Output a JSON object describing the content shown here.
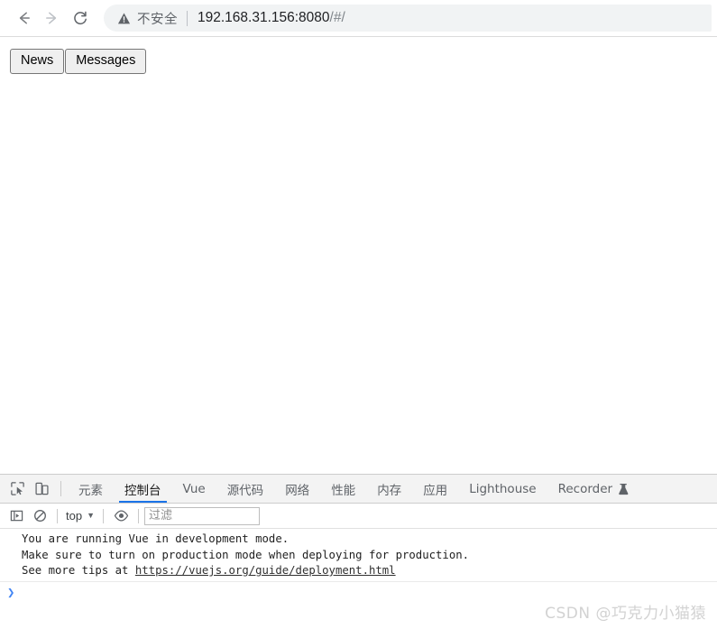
{
  "browser": {
    "nav": {
      "back_label": "Back",
      "forward_label": "Forward",
      "reload_label": "Reload"
    },
    "omnibox": {
      "security_icon": "warning-triangle-icon",
      "security_text": "不安全",
      "url_host": "192.168.31.156:8080",
      "url_path": "/#/"
    }
  },
  "page": {
    "buttons": [
      {
        "label": "News"
      },
      {
        "label": "Messages"
      }
    ]
  },
  "devtools": {
    "toolbar_icons": [
      {
        "name": "inspect-element-icon"
      },
      {
        "name": "device-toolbar-icon"
      }
    ],
    "tabs": [
      {
        "label": "元素",
        "active": false
      },
      {
        "label": "控制台",
        "active": true
      },
      {
        "label": "Vue",
        "active": false
      },
      {
        "label": "源代码",
        "active": false
      },
      {
        "label": "网络",
        "active": false
      },
      {
        "label": "性能",
        "active": false
      },
      {
        "label": "内存",
        "active": false
      },
      {
        "label": "应用",
        "active": false
      },
      {
        "label": "Lighthouse",
        "active": false
      },
      {
        "label": "Recorder",
        "active": false,
        "icon": "flask-icon"
      }
    ],
    "console_toolbar": {
      "sidebar_toggle_icon": "console-sidebar-icon",
      "clear_icon": "clear-console-icon",
      "context_value": "top",
      "context_caret": "▼",
      "eye_icon": "live-expression-eye-icon",
      "filter_placeholder": "过滤",
      "filter_value": ""
    },
    "console_messages": [
      {
        "line1": "You are running Vue in development mode.",
        "line2": "Make sure to turn on production mode when deploying for production.",
        "line3_prefix": "See more tips at ",
        "line3_link": "https://vuejs.org/guide/deployment.html"
      }
    ],
    "prompt_caret": "❯"
  },
  "watermark": {
    "text": "CSDN @巧克力小猫猿"
  },
  "colors": {
    "accent_blue": "#1a73e8",
    "prompt_blue": "#4285f4",
    "omnibox_bg": "#f1f3f4",
    "tabbar_bg": "#f3f3f3"
  }
}
